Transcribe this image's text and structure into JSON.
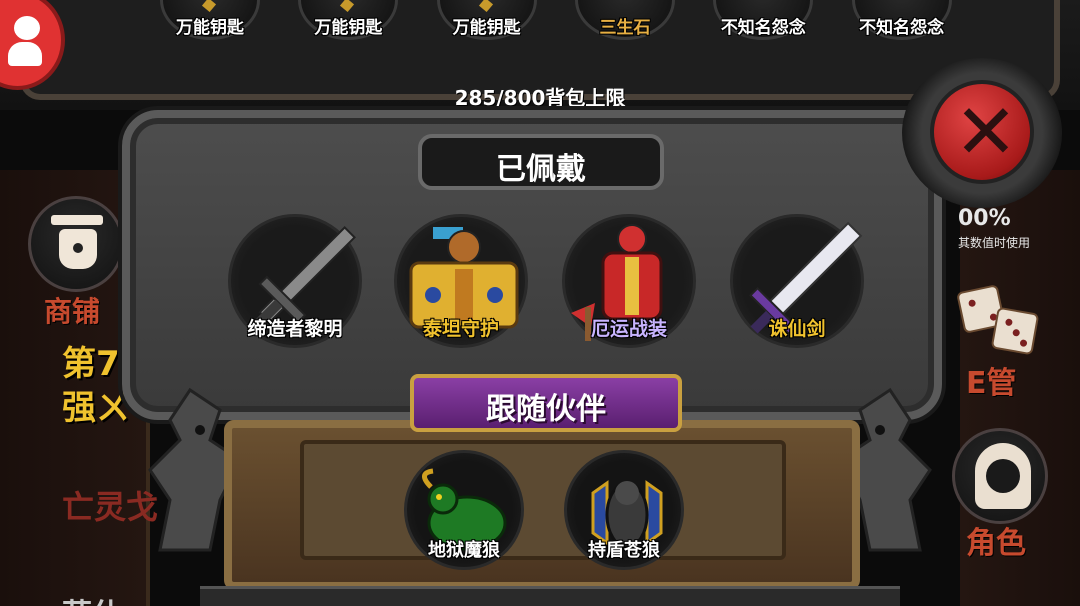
{
  "top_items": [
    {
      "label": "万能钥匙",
      "special": false
    },
    {
      "label": "万能钥匙",
      "special": false
    },
    {
      "label": "万能钥匙",
      "special": false
    },
    {
      "label": "三生石",
      "special": true
    },
    {
      "label": "不知名怨念",
      "special": false
    },
    {
      "label": "不知名怨念",
      "special": false
    }
  ],
  "bag_limit": "285/800背包上限",
  "equipped": {
    "title": "已佩戴",
    "items": [
      {
        "name": "缔造者黎明",
        "color": "#ffffff"
      },
      {
        "name": "泰坦守护",
        "color": "#f0c22e"
      },
      {
        "name": "厄运战装",
        "color": "#c8b4ff"
      },
      {
        "name": "诛仙剑",
        "color": "#f0c22e"
      }
    ]
  },
  "companions": {
    "title": "跟随伙伴",
    "items": [
      {
        "name": "地狱魔狼"
      },
      {
        "name": "持盾苍狼"
      }
    ]
  },
  "left_side": {
    "shop_label": "商铺",
    "line1": "第7",
    "line2": "强ㄨ",
    "line3": "亡灵戈",
    "line4": "菲休"
  },
  "right_side": {
    "num": "00%",
    "hint": "其数值时使用",
    "manage_label": "E管",
    "role_label": "角色"
  },
  "colors": {
    "accent_gold": "#f0c22e",
    "accent_red": "#c74a2e",
    "close_red": "#e04444",
    "companion_purple": "#8a3fa5"
  }
}
